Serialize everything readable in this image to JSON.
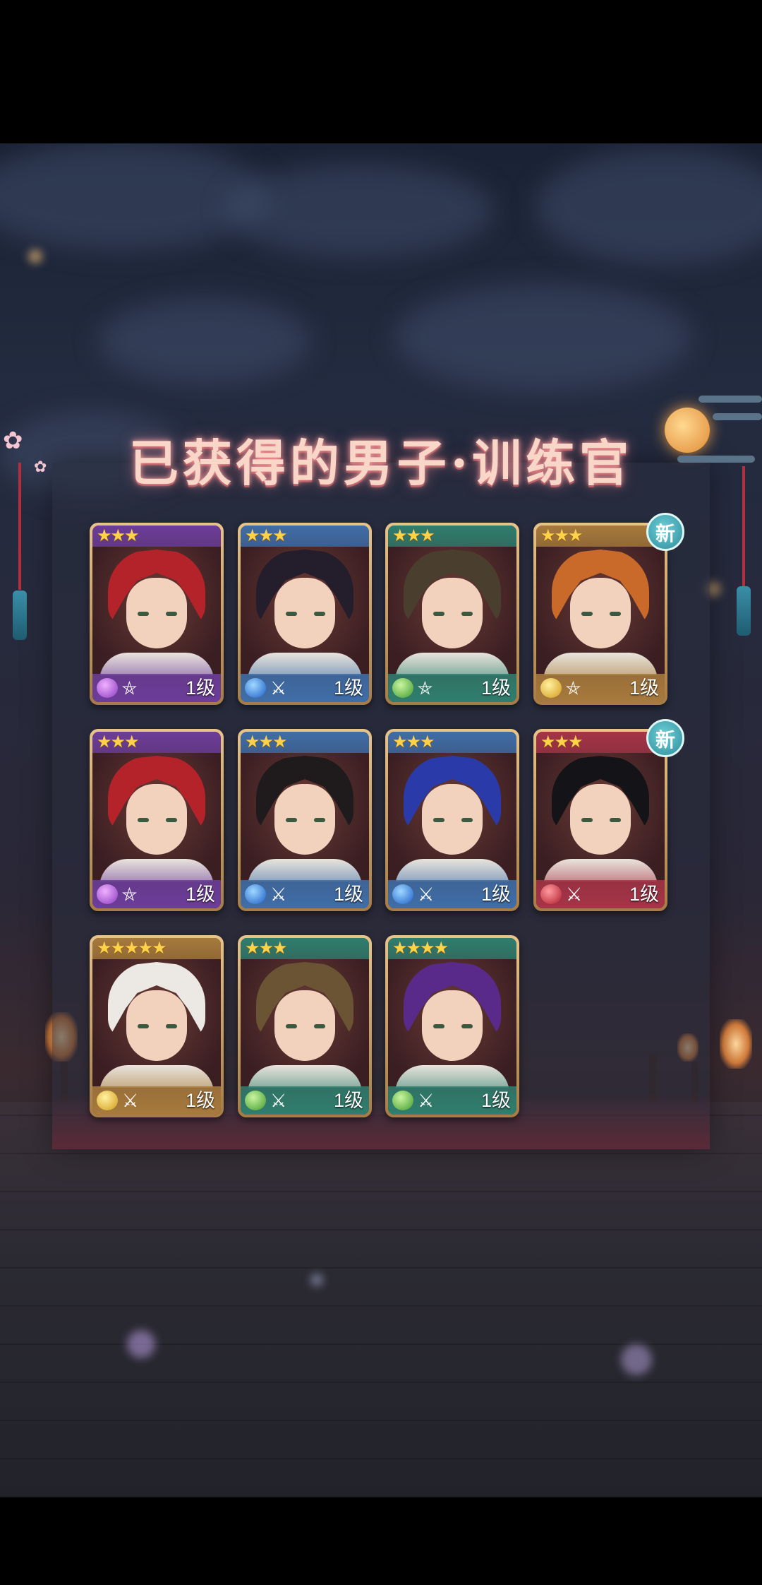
{
  "title": "已获得的男子·训练官",
  "new_badge_label": "新",
  "level_text": "1级",
  "colors": {
    "purple": "#6c3d9a",
    "blue": "#3f6ea8",
    "green": "#2f7e6e",
    "gold": "#a77a3c",
    "red": "#a53447"
  },
  "cards": [
    {
      "stars": "★★★",
      "rarity_color": "purple",
      "element": "purple-crystal",
      "class_icon": "pentagram-icon",
      "level": "1级",
      "hair": "#b5232a",
      "is_new": false
    },
    {
      "stars": "★★★",
      "rarity_color": "blue",
      "element": "blue-water",
      "class_icon": "crossed-swords-icon",
      "level": "1级",
      "hair": "#241d2c",
      "is_new": false
    },
    {
      "stars": "★★★",
      "rarity_color": "green",
      "element": "green-leaf",
      "class_icon": "pentagram-icon",
      "level": "1级",
      "hair": "#4a3f2f",
      "is_new": false
    },
    {
      "stars": "★★★",
      "rarity_color": "gold",
      "element": "gold-earth",
      "class_icon": "pentagram-icon",
      "level": "1级",
      "hair": "#c96a2a",
      "is_new": true
    },
    {
      "stars": "★★★",
      "rarity_color": "purple",
      "element": "purple-crystal",
      "class_icon": "pentagram-icon",
      "level": "1级",
      "hair": "#b5232a",
      "is_new": false
    },
    {
      "stars": "★★★",
      "rarity_color": "blue",
      "element": "blue-water",
      "class_icon": "crossed-swords-icon",
      "level": "1级",
      "hair": "#1f1a1c",
      "is_new": false
    },
    {
      "stars": "★★★",
      "rarity_color": "blue",
      "element": "blue-water",
      "class_icon": "crossed-swords-icon",
      "level": "1级",
      "hair": "#2a3aa8",
      "is_new": false
    },
    {
      "stars": "★★★",
      "rarity_color": "red",
      "element": "red-fire",
      "class_icon": "crossed-swords-icon",
      "level": "1级",
      "hair": "#141418",
      "is_new": true
    },
    {
      "stars": "★★★★★",
      "rarity_color": "gold",
      "element": "gold-earth",
      "class_icon": "crossed-swords-icon",
      "level": "1级",
      "hair": "#ece8e4",
      "is_new": false
    },
    {
      "stars": "★★★",
      "rarity_color": "green",
      "element": "green-leaf",
      "class_icon": "crossed-swords-icon",
      "level": "1级",
      "hair": "#6a5434",
      "is_new": false
    },
    {
      "stars": "★★★★",
      "rarity_color": "green",
      "element": "green-leaf",
      "class_icon": "crossed-swords-icon",
      "level": "1级",
      "hair": "#5a2a8a",
      "is_new": false
    }
  ]
}
